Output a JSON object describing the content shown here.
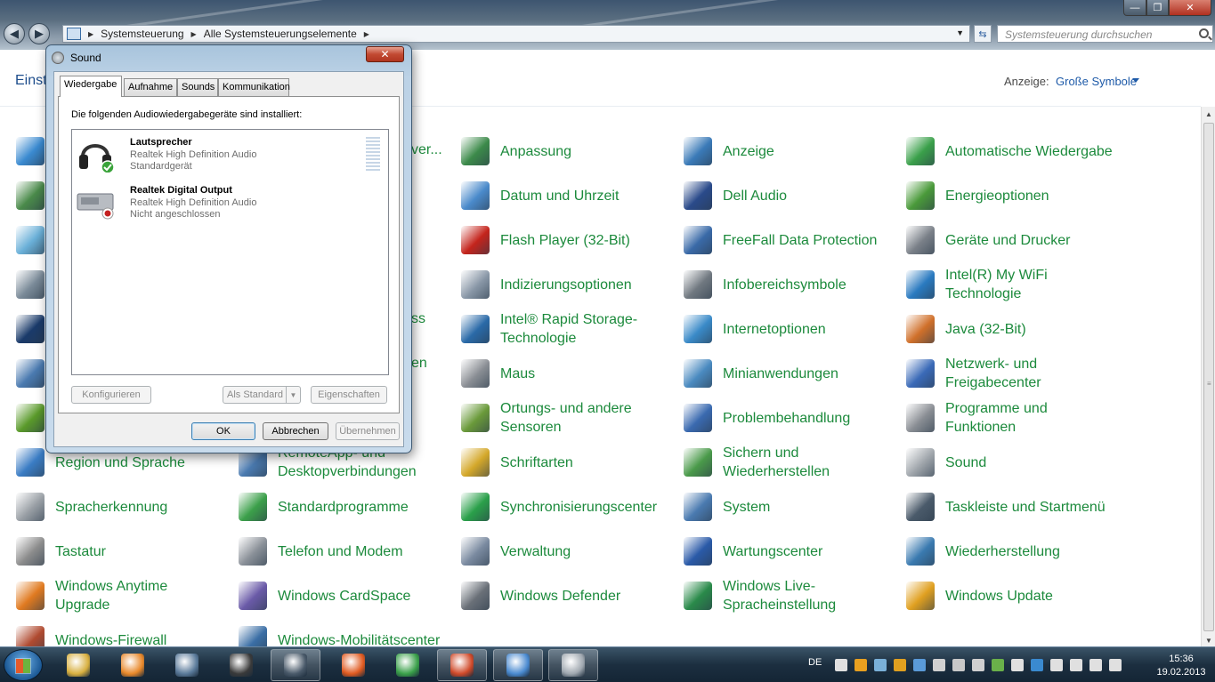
{
  "window": {
    "min_glyph": "—",
    "max_glyph": "❐",
    "close_glyph": "✕"
  },
  "address": {
    "crumbs": [
      "Systemsteuerung",
      "Alle Systemsteuerungselemente"
    ],
    "search_placeholder": "Systemsteuerung durchsuchen"
  },
  "header": {
    "left_text": "Einst",
    "view_label": "Anzeige:",
    "view_value": "Große Symbole"
  },
  "items": [
    {
      "label": "Region und Sprache",
      "icon": "globe-clock-icon",
      "color": "#3a7cc4"
    },
    {
      "label": "Spracherkennung",
      "icon": "microphone-icon",
      "color": "#9aa0a6"
    },
    {
      "label": "Tastatur",
      "icon": "keyboard-icon",
      "color": "#8c8c8c"
    },
    {
      "label": "Windows Anytime Upgrade",
      "icon": "windows-logo-icon",
      "color": "#e07a20"
    },
    {
      "label": "Windows-Firewall",
      "icon": "firewall-icon",
      "color": "#b04a30"
    },
    {
      "label": "RemoteApp- und Desktopverbindungen",
      "icon": "remote-desktop-icon",
      "color": "#4a7ab0"
    },
    {
      "label": "Standardprogramme",
      "icon": "default-programs-icon",
      "color": "#3ca04a"
    },
    {
      "label": "Telefon und Modem",
      "icon": "phone-modem-icon",
      "color": "#8a9098"
    },
    {
      "label": "Windows CardSpace",
      "icon": "cardspace-icon",
      "color": "#6a5aa8"
    },
    {
      "label": "Windows-Mobilitätscenter",
      "icon": "mobility-center-icon",
      "color": "#3a6ea5"
    },
    {
      "label": "Anpassung",
      "icon": "personalization-icon",
      "color": "#3c8a4a"
    },
    {
      "label": "Datum und Uhrzeit",
      "icon": "calendar-clock-icon",
      "color": "#4a8acb"
    },
    {
      "label": "Flash Player (32-Bit)",
      "icon": "flash-icon",
      "color": "#c4241c"
    },
    {
      "label": "Indizierungsoptionen",
      "icon": "indexing-icon",
      "color": "#8a98a8"
    },
    {
      "label": "Intel® Rapid Storage-Technologie",
      "icon": "rapid-storage-icon",
      "color": "#2a6aa8"
    },
    {
      "label": "Maus",
      "icon": "mouse-icon",
      "color": "#8a8e94"
    },
    {
      "label": "Ortungs- und andere Sensoren",
      "icon": "sensors-icon",
      "color": "#6a9a3a"
    },
    {
      "label": "Schriftarten",
      "icon": "fonts-icon",
      "color": "#d4a82a"
    },
    {
      "label": "Synchronisierungscenter",
      "icon": "sync-center-icon",
      "color": "#2aa04a"
    },
    {
      "label": "Verwaltung",
      "icon": "admin-tools-icon",
      "color": "#7a8aa0"
    },
    {
      "label": "Windows Defender",
      "icon": "defender-icon",
      "color": "#6a7078"
    },
    {
      "label": "Anzeige",
      "icon": "display-icon",
      "color": "#3a7ab8"
    },
    {
      "label": "Dell Audio",
      "icon": "dell-audio-icon",
      "color": "#2a4a8a"
    },
    {
      "label": "FreeFall Data Protection",
      "icon": "freefall-icon",
      "color": "#3a6aa8"
    },
    {
      "label": "Infobereichsymbole",
      "icon": "notification-icons-icon",
      "color": "#707880"
    },
    {
      "label": "Internetoptionen",
      "icon": "internet-options-icon",
      "color": "#3a8ac8"
    },
    {
      "label": "Minianwendungen",
      "icon": "gadgets-icon",
      "color": "#4a8ac0"
    },
    {
      "label": "Problembehandlung",
      "icon": "troubleshooting-icon",
      "color": "#3a6ab0"
    },
    {
      "label": "Sichern und Wiederherstellen",
      "icon": "backup-icon",
      "color": "#4a9a4a"
    },
    {
      "label": "System",
      "icon": "system-icon",
      "color": "#4a7ab0"
    },
    {
      "label": "Wartungscenter",
      "icon": "action-center-flag-icon",
      "color": "#2a5aa8"
    },
    {
      "label": "Windows Live-Spracheinstellung",
      "icon": "live-language-icon",
      "color": "#2a8a4a"
    },
    {
      "label": "Automatische Wiedergabe",
      "icon": "autoplay-icon",
      "color": "#3aa04a"
    },
    {
      "label": "Energieoptionen",
      "icon": "power-options-icon",
      "color": "#4a9a3a"
    },
    {
      "label": "Geräte und Drucker",
      "icon": "devices-printers-icon",
      "color": "#7a8088"
    },
    {
      "label": "Intel(R) My WiFi Technologie",
      "icon": "wifi-tech-icon",
      "color": "#2a7ac0"
    },
    {
      "label": "Java (32-Bit)",
      "icon": "java-icon",
      "color": "#d0702a"
    },
    {
      "label": "Netzwerk- und Freigabecenter",
      "icon": "network-center-icon",
      "color": "#3a6ab8"
    },
    {
      "label": "Programme und Funktionen",
      "icon": "programs-features-icon",
      "color": "#8a8e94"
    },
    {
      "label": "Sound",
      "icon": "sound-icon",
      "color": "#a0a6ac"
    },
    {
      "label": "Taskleiste und Startmenü",
      "icon": "taskbar-startmenu-icon",
      "color": "#4a5a6a"
    },
    {
      "label": "Wiederherstellung",
      "icon": "recovery-icon",
      "color": "#3a7ab0"
    },
    {
      "label": "Windows Update",
      "icon": "windows-update-icon",
      "color": "#e0a020"
    }
  ],
  "left_partial_icons": [
    {
      "icon": "ie-icon",
      "color": "#3a8ad0"
    },
    {
      "icon": "users-icon",
      "color": "#4a8a4a"
    },
    {
      "icon": "documents-icon",
      "color": "#6ab0d8"
    },
    {
      "icon": "device-manager-icon",
      "color": "#7a8a98"
    },
    {
      "icon": "display-settings-icon",
      "color": "#1a3a6a"
    },
    {
      "icon": "parental-controls-icon",
      "color": "#4a7ab0"
    },
    {
      "icon": "nvidia-icon",
      "color": "#5a9a2a"
    }
  ],
  "partial_texts": [
    "ver...",
    "ss",
    "en"
  ],
  "dialog": {
    "title": "Sound",
    "close_glyph": "✕",
    "tabs": [
      "Wiedergabe",
      "Aufnahme",
      "Sounds",
      "Kommunikation"
    ],
    "caption": "Die folgenden Audiowiedergabegeräte sind installiert:",
    "devices": [
      {
        "name": "Lautsprecher",
        "line1": "Realtek High Definition Audio",
        "line2": "Standardgerät"
      },
      {
        "name": "Realtek Digital Output",
        "line1": "Realtek High Definition Audio",
        "line2": "Nicht angeschlossen"
      }
    ],
    "buttons": {
      "configure": "Konfigurieren",
      "set_default": "Als Standard",
      "properties": "Eigenschaften",
      "ok": "OK",
      "cancel": "Abbrechen",
      "apply": "Übernehmen"
    }
  },
  "taskbar": {
    "apps": [
      {
        "name": "explorer-icon",
        "color": "#d8b040"
      },
      {
        "name": "media-player-icon",
        "color": "#e8882a"
      },
      {
        "name": "computer-icon",
        "color": "#5a7a9a"
      },
      {
        "name": "webcam-icon",
        "color": "#3a3a3a"
      },
      {
        "name": "steam-icon",
        "color": "#4a5a6a"
      },
      {
        "name": "firefox-icon",
        "color": "#e05a20"
      },
      {
        "name": "chrome-icon",
        "color": "#3aa04a"
      },
      {
        "name": "chrome-alt-icon",
        "color": "#d04a2a"
      },
      {
        "name": "control-panel-icon",
        "color": "#4a8ad0"
      },
      {
        "name": "sound-app-icon",
        "color": "#a0a8b0"
      }
    ],
    "lang": "DE",
    "time": "15:36",
    "date": "19.02.2013",
    "tray_colors": [
      "#e0e0e0",
      "#e8a020",
      "#7ab0d8",
      "#e0a020",
      "#5a9ad8",
      "#d0d0d0",
      "#c8c8c8",
      "#d0d0d0",
      "#6ab04a",
      "#e0e0e0",
      "#3a8ad0",
      "#e0e0e0",
      "#e0e0e0",
      "#e0e0e0",
      "#e0e0e0"
    ]
  }
}
